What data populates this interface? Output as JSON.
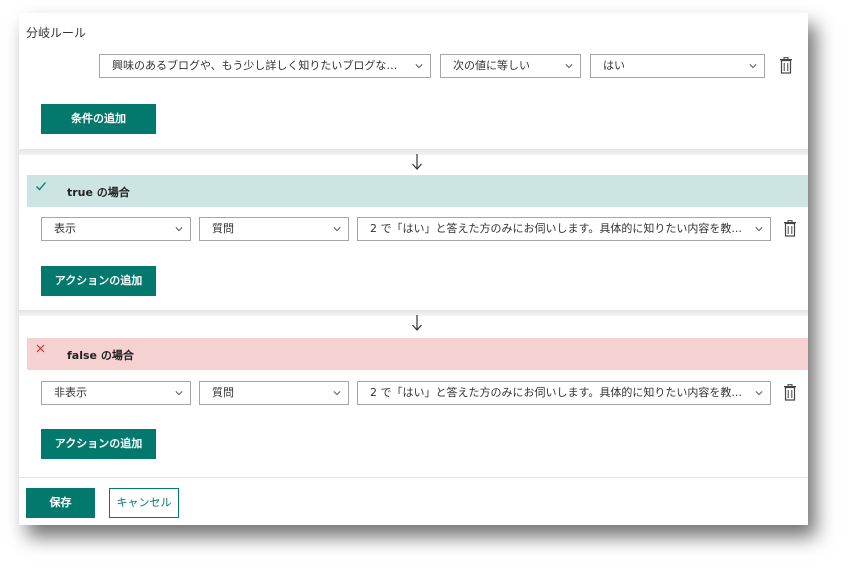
{
  "branch": {
    "title": "分岐ルール",
    "condition": {
      "question": "興味のあるブログや、もう少し詳しく知りたいブログなど...",
      "operator": "次の値に等しい",
      "value": "はい"
    },
    "add_condition_label": "条件の追加"
  },
  "true_block": {
    "header": "true の場合",
    "action": "表示",
    "target_type": "質問",
    "target": "2 で「はい」と答えた方のみにお伺いします。具体的に知りたい内容を教...",
    "add_action_label": "アクションの追加"
  },
  "false_block": {
    "header": "false の場合",
    "action": "非表示",
    "target_type": "質問",
    "target": "2 で「はい」と答えた方のみにお伺いします。具体的に知りたい内容を教...",
    "add_action_label": "アクションの追加"
  },
  "footer": {
    "save_label": "保存",
    "cancel_label": "キャンセル"
  },
  "colors": {
    "accent": "#03786d",
    "true_bg": "#cde5e2",
    "false_bg": "#f5d1d1"
  }
}
